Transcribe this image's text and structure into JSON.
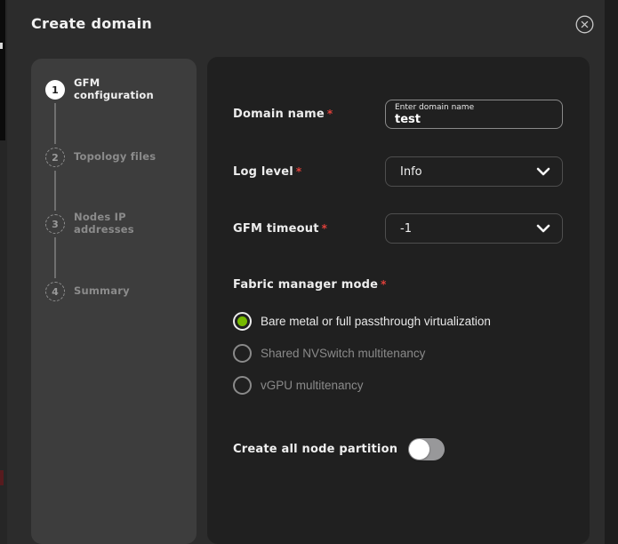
{
  "modal": {
    "title": "Create domain"
  },
  "icons": {
    "close": "circled-x",
    "dropdown": "chevron-down"
  },
  "stepper": {
    "steps": [
      {
        "number": "1",
        "label": "GFM configuration",
        "state": "active"
      },
      {
        "number": "2",
        "label": "Topology files",
        "state": "upcoming"
      },
      {
        "number": "3",
        "label": "Nodes IP addresses",
        "state": "upcoming"
      },
      {
        "number": "4",
        "label": "Summary",
        "state": "upcoming"
      }
    ]
  },
  "form": {
    "required_marker": "*",
    "domain_name": {
      "label": "Domain name",
      "placeholder": "Enter domain name",
      "value": "test"
    },
    "log_level": {
      "label": "Log level",
      "value": "Info"
    },
    "gfm_timeout": {
      "label": "GFM timeout",
      "value": "-1"
    },
    "fabric_manager_mode": {
      "label": "Fabric manager mode",
      "options": [
        {
          "label": "Bare metal or full passthrough virtualization",
          "selected": true
        },
        {
          "label": "Shared NVSwitch multitenancy",
          "selected": false
        },
        {
          "label": "vGPU multitenancy",
          "selected": false
        }
      ]
    },
    "create_all_node_partition": {
      "label": "Create all node partition",
      "enabled": false
    }
  },
  "colors": {
    "accent_green": "#76b900",
    "required_asterisk": "#e0403a",
    "panel_stepper": "#3d3d3d",
    "panel_form": "#202020",
    "modal_background": "#2c2c2c"
  }
}
